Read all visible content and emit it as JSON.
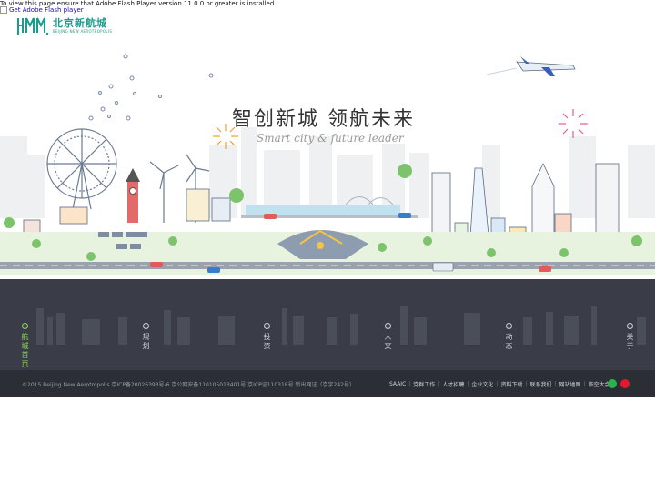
{
  "flash_notice": "To view this page ensure that Adobe Flash Player version 11.0.0 or greater is installed.",
  "get_flash_alt": "Get Adobe Flash player",
  "logo": {
    "cn": "北京新航城",
    "en": "BEIJING NEW AEROTROPOLIS"
  },
  "hero": {
    "slogan_cn": "智创新城  领航未来",
    "slogan_en": "Smart city & future leader"
  },
  "nav": {
    "items": [
      {
        "label": "航城首页",
        "active": true
      },
      {
        "label": "规划",
        "active": false
      },
      {
        "label": "投资",
        "active": false
      },
      {
        "label": "人文",
        "active": false
      },
      {
        "label": "动态",
        "active": false
      },
      {
        "label": "关于",
        "active": false
      }
    ]
  },
  "footer": {
    "copyright": "©2015 Beijing New Aerotropolis 京ICP备20026393号-6 京公网安备110105013401号 京ICP证110318号 新出网证（京字242号）",
    "links": [
      "SAAIC",
      "党群工作",
      "人才招聘",
      "企业文化",
      "资料下载",
      "联系我们",
      "网站地图",
      "临空大会"
    ]
  },
  "colors": {
    "accent": "#8bd35a",
    "band": "#3a3d47",
    "footer": "#2c2e36",
    "brand": "#1a9c8c"
  }
}
